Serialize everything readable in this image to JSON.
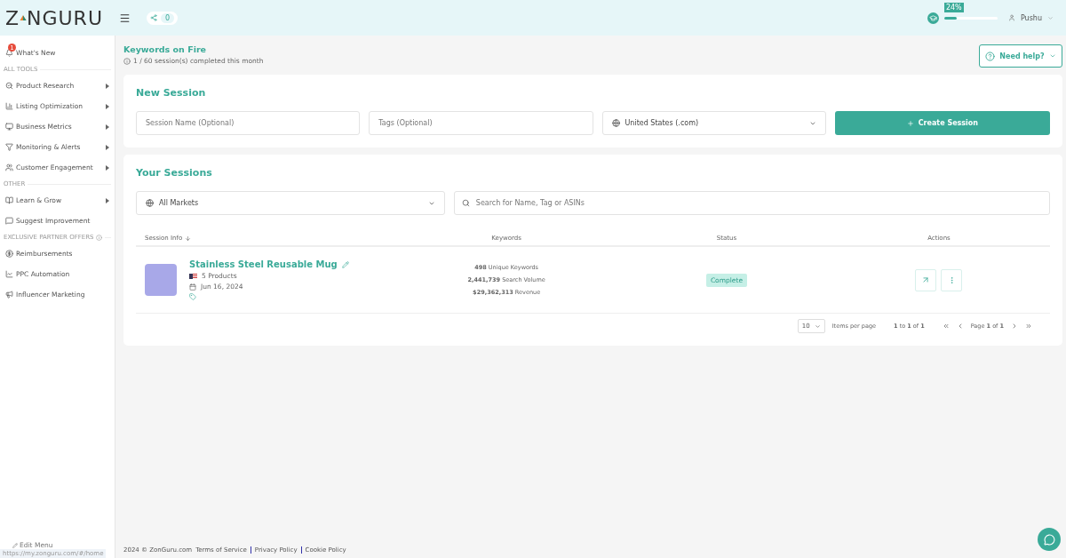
{
  "header": {
    "logo_before": "Z",
    "logo_after": "NGURU",
    "notifications_count": "0",
    "progress_label": "24%",
    "level": 0.24,
    "user": "Pushu"
  },
  "sidebar": {
    "items": [
      {
        "kind": "item",
        "label": "What's New",
        "badge": "1",
        "has_submenu": false
      },
      {
        "kind": "section",
        "label": "ALL TOOLS"
      },
      {
        "kind": "item",
        "label": "Product Research",
        "has_submenu": true
      },
      {
        "kind": "item",
        "label": "Listing Optimization",
        "has_submenu": true
      },
      {
        "kind": "item",
        "label": "Business Metrics",
        "has_submenu": true
      },
      {
        "kind": "item",
        "label": "Monitoring & Alerts",
        "has_submenu": true
      },
      {
        "kind": "item",
        "label": "Customer Engagement",
        "has_submenu": true
      },
      {
        "kind": "section",
        "label": "OTHER"
      },
      {
        "kind": "item",
        "label": "Learn & Grow",
        "has_submenu": true
      },
      {
        "kind": "item",
        "label": "Suggest Improvement",
        "has_submenu": false
      },
      {
        "kind": "section",
        "label": "EXCLUSIVE PARTNER OFFERS",
        "info": true
      },
      {
        "kind": "item",
        "label": "Reimbursements",
        "has_submenu": false
      },
      {
        "kind": "item",
        "label": "PPC Automation",
        "has_submenu": false
      },
      {
        "kind": "item",
        "label": "Influencer Marketing",
        "has_submenu": false
      }
    ],
    "edit_menu": "Edit Menu",
    "status_url": "https://my.zonguru.com/#/home"
  },
  "page": {
    "title": "Keywords on Fire",
    "subtitle": "1 / 60 session(s) completed this month",
    "help_button": "Need help?"
  },
  "new_session": {
    "title": "New Session",
    "name_placeholder": "Session Name (Optional)",
    "tags_placeholder": "Tags (Optional)",
    "market": "United States (.com)",
    "create_button": "Create Session"
  },
  "sessions": {
    "title": "Your Sessions",
    "market_filter": "All Markets",
    "search_placeholder": "Search for Name, Tag or ASINs",
    "columns": [
      "Session Info",
      "Keywords",
      "Status",
      "Actions"
    ],
    "rows": [
      {
        "name": "Stainless Steel Reusable Mug",
        "products": "5 Products",
        "date": "Jun 16, 2024",
        "stats": [
          "**498** Unique Keywords",
          "**2,441,739** Search Volume",
          "**$29,362,313** Revenue"
        ],
        "status": "Complete"
      }
    ],
    "pagination": {
      "page_size": "10",
      "items_per_page": "Items per page",
      "range": "**1** to **1** of **1**",
      "page": "Page **1** of **1**"
    }
  },
  "footer": {
    "copyright": "2024 © ZonGuru.com",
    "links": [
      "Terms of Service",
      "Privacy Policy",
      "Cookie Policy"
    ]
  }
}
